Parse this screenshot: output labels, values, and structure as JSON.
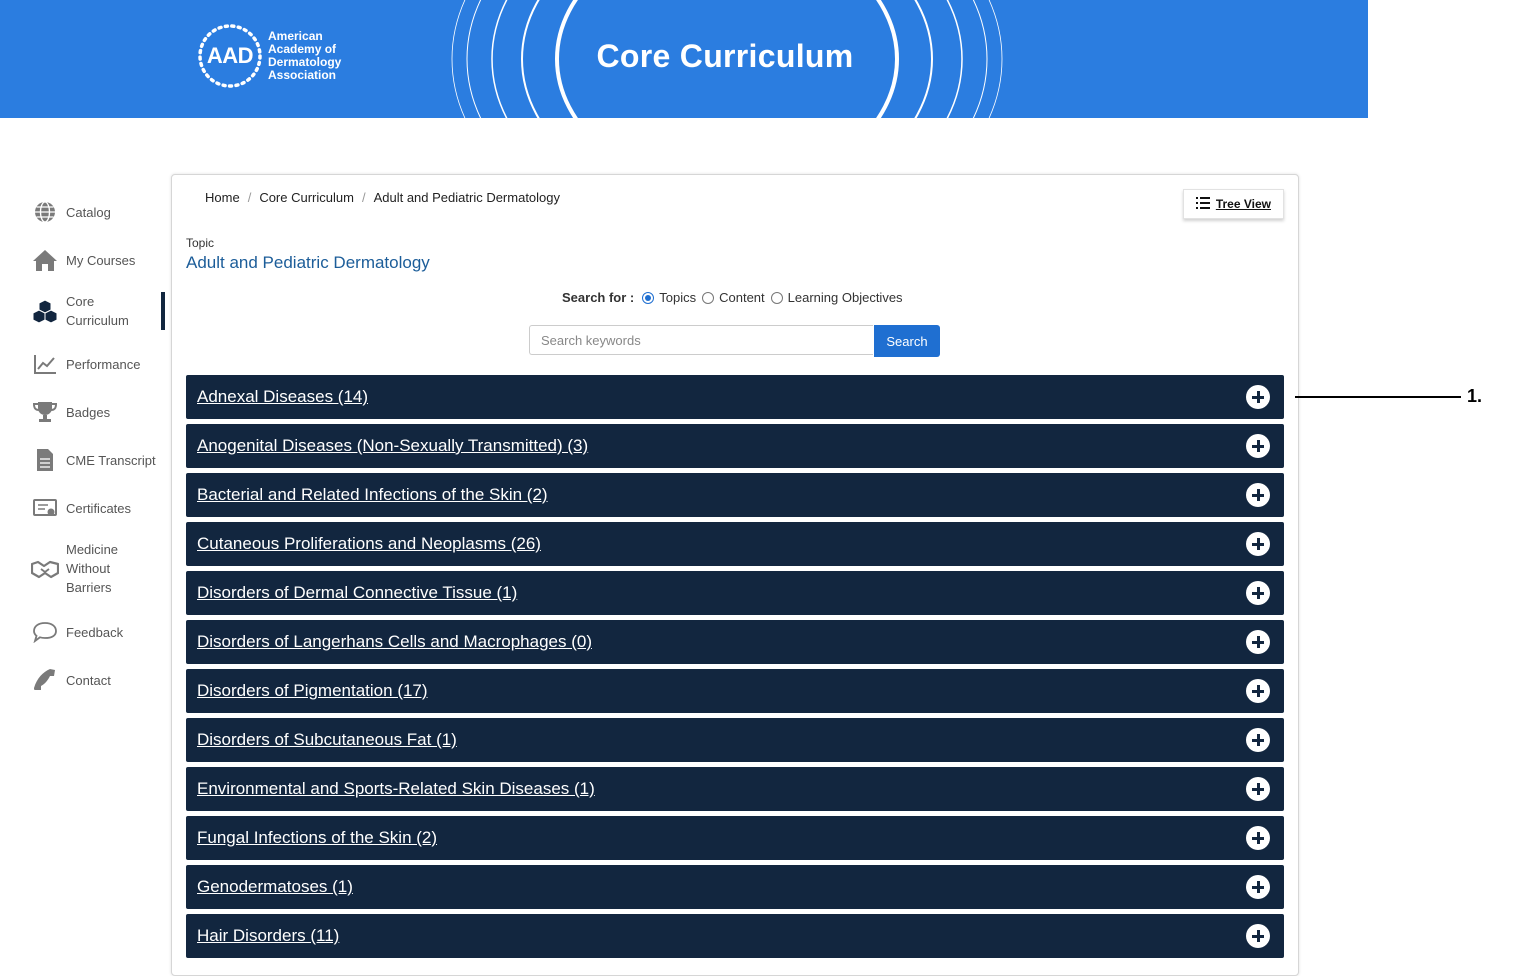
{
  "banner": {
    "logo_mark": "AAD",
    "logo_lines": [
      "American",
      "Academy of",
      "Dermatology",
      "Association"
    ],
    "title": "Core Curriculum",
    "background": "#2b7de0"
  },
  "sidebar": {
    "items": [
      {
        "label": "Catalog",
        "icon": "globe-icon"
      },
      {
        "label": "My Courses",
        "icon": "home-icon"
      },
      {
        "label": "Core Curriculum",
        "icon": "cubes-icon",
        "active": true
      },
      {
        "label": "Performance",
        "icon": "line-chart-icon"
      },
      {
        "label": "Badges",
        "icon": "trophy-icon"
      },
      {
        "label": "CME Transcript",
        "icon": "document-icon"
      },
      {
        "label": "Certificates",
        "icon": "certificate-icon"
      },
      {
        "label": "Medicine Without Barriers",
        "icon": "handshake-icon"
      },
      {
        "label": "Feedback",
        "icon": "speech-bubble-icon"
      },
      {
        "label": "Contact",
        "icon": "phone-icon"
      }
    ]
  },
  "breadcrumb": [
    "Home",
    "Core Curriculum",
    "Adult and Pediatric Dermatology"
  ],
  "tree_view": {
    "label": "Tree View",
    "icon": "list-icon"
  },
  "topic": {
    "label": "Topic",
    "title": "Adult and Pediatric Dermatology"
  },
  "search": {
    "for_label": "Search for :",
    "options": [
      {
        "label": "Topics",
        "selected": true
      },
      {
        "label": "Content",
        "selected": false
      },
      {
        "label": "Learning Objectives",
        "selected": false
      }
    ],
    "placeholder": "Search keywords",
    "value": "",
    "button_label": "Search"
  },
  "topics": [
    "Adnexal Diseases (14)",
    "Anogenital Diseases (Non-Sexually Transmitted) (3)",
    "Bacterial and Related Infections of the Skin (2)",
    "Cutaneous Proliferations and Neoplasms (26)",
    "Disorders of Dermal Connective Tissue (1)",
    "Disorders of Langerhans Cells and Macrophages (0)",
    "Disorders of Pigmentation (17)",
    "Disorders of Subcutaneous Fat (1)",
    "Environmental and Sports-Related Skin Diseases (1)",
    "Fungal Infections of the Skin (2)",
    "Genodermatoses (1)",
    "Hair Disorders (11)"
  ],
  "callout": {
    "label": "1."
  },
  "colors": {
    "accent": "#1f6fd1",
    "row_bg": "#12263f",
    "topic_title": "#1c5d99"
  }
}
